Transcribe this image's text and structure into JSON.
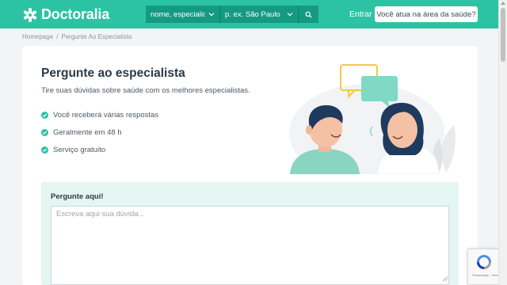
{
  "header": {
    "brand": "Doctoralia",
    "specialty_placeholder": "nome, especialidade",
    "location_placeholder": "p. ex. São Paulo",
    "login_label": "Entrar",
    "professional_cta": "Você atua na área da saúde?"
  },
  "breadcrumb": {
    "home": "Homepage",
    "separator": "/",
    "current": "Pergunte Ao Especialista"
  },
  "hero": {
    "title": "Pergunte ao especialista",
    "subtitle": "Tire suas dúvidas sobre saúde com os melhores especialistas.",
    "benefits": [
      "Você receberá várias respostas",
      "Geralmente em 48 h",
      "Serviço gratuito"
    ]
  },
  "ask": {
    "label": "Pergunte aqui!",
    "placeholder": "Escreva aqui sua dúvida..."
  },
  "recaptcha": {
    "caption": "Privacidade - Termos"
  },
  "colors": {
    "brand": "#2bc3a4",
    "brand_dark": "#159a82",
    "ask_background": "#e3f6f1",
    "page_background": "#f2f4f5"
  },
  "icons": {
    "logo": "doctoralia-star-icon",
    "dropdown": "chevron-down-icon",
    "search": "search-icon",
    "benefit": "check-circle-icon",
    "captcha": "recaptcha-icon"
  }
}
